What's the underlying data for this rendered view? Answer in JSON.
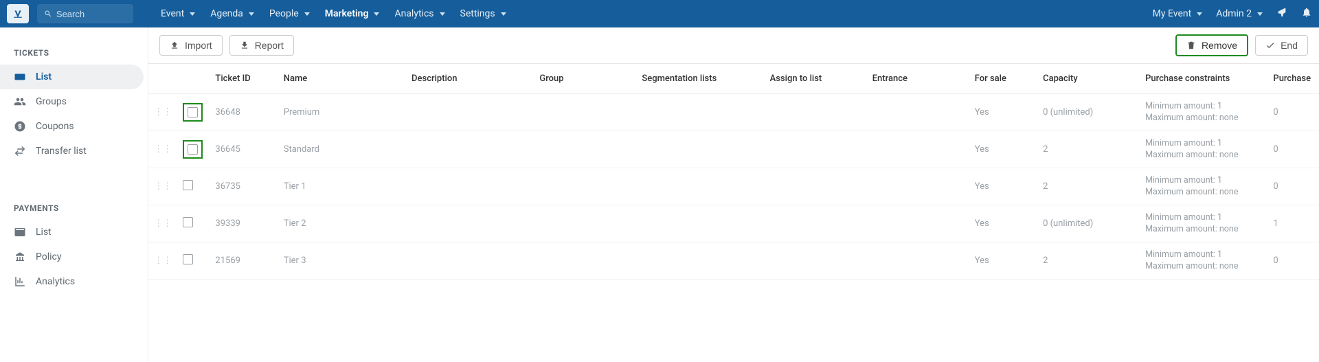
{
  "topbar": {
    "search_placeholder": "Search",
    "menu": [
      {
        "label": "Event",
        "active": false
      },
      {
        "label": "Agenda",
        "active": false
      },
      {
        "label": "People",
        "active": false
      },
      {
        "label": "Marketing",
        "active": true
      },
      {
        "label": "Analytics",
        "active": false
      },
      {
        "label": "Settings",
        "active": false
      }
    ],
    "event_label": "My Event",
    "user_label": "Admin 2"
  },
  "sidebar": {
    "section1_title": "TICKETS",
    "section1_items": [
      {
        "label": "List",
        "icon": "ticket",
        "active": true
      },
      {
        "label": "Groups",
        "icon": "users",
        "active": false
      },
      {
        "label": "Coupons",
        "icon": "coin",
        "active": false
      },
      {
        "label": "Transfer list",
        "icon": "transfer",
        "active": false
      }
    ],
    "section2_title": "PAYMENTS",
    "section2_items": [
      {
        "label": "List",
        "icon": "card",
        "active": false
      },
      {
        "label": "Policy",
        "icon": "bank",
        "active": false
      },
      {
        "label": "Analytics",
        "icon": "chart",
        "active": false
      }
    ]
  },
  "toolbar": {
    "import_label": "Import",
    "report_label": "Report",
    "remove_label": "Remove",
    "end_label": "End"
  },
  "table": {
    "headers": {
      "ticket_id": "Ticket ID",
      "name": "Name",
      "description": "Description",
      "group": "Group",
      "segmentation": "Segmentation lists",
      "assign": "Assign to list",
      "entrance": "Entrance",
      "for_sale": "For sale",
      "capacity": "Capacity",
      "constraints": "Purchase constraints",
      "purchase": "Purchase"
    },
    "rows": [
      {
        "id": "36648",
        "name": "Premium",
        "for_sale": "Yes",
        "capacity": "0 (unlimited)",
        "min": "Minimum amount: 1",
        "max": "Maximum amount: none",
        "purchase": "0",
        "hl_check": true
      },
      {
        "id": "36645",
        "name": "Standard",
        "for_sale": "Yes",
        "capacity": "2",
        "min": "Minimum amount: 1",
        "max": "Maximum amount: none",
        "purchase": "0",
        "hl_check": true
      },
      {
        "id": "36735",
        "name": "Tier 1",
        "for_sale": "Yes",
        "capacity": "2",
        "min": "Minimum amount: 1",
        "max": "Maximum amount: none",
        "purchase": "0",
        "hl_check": false
      },
      {
        "id": "39339",
        "name": "Tier 2",
        "for_sale": "Yes",
        "capacity": "0 (unlimited)",
        "min": "Minimum amount: 1",
        "max": "Maximum amount: none",
        "purchase": "1",
        "hl_check": false
      },
      {
        "id": "21569",
        "name": "Tier 3",
        "for_sale": "Yes",
        "capacity": "2",
        "min": "Minimum amount: 1",
        "max": "Maximum amount: none",
        "purchase": "0",
        "hl_check": false
      }
    ]
  }
}
